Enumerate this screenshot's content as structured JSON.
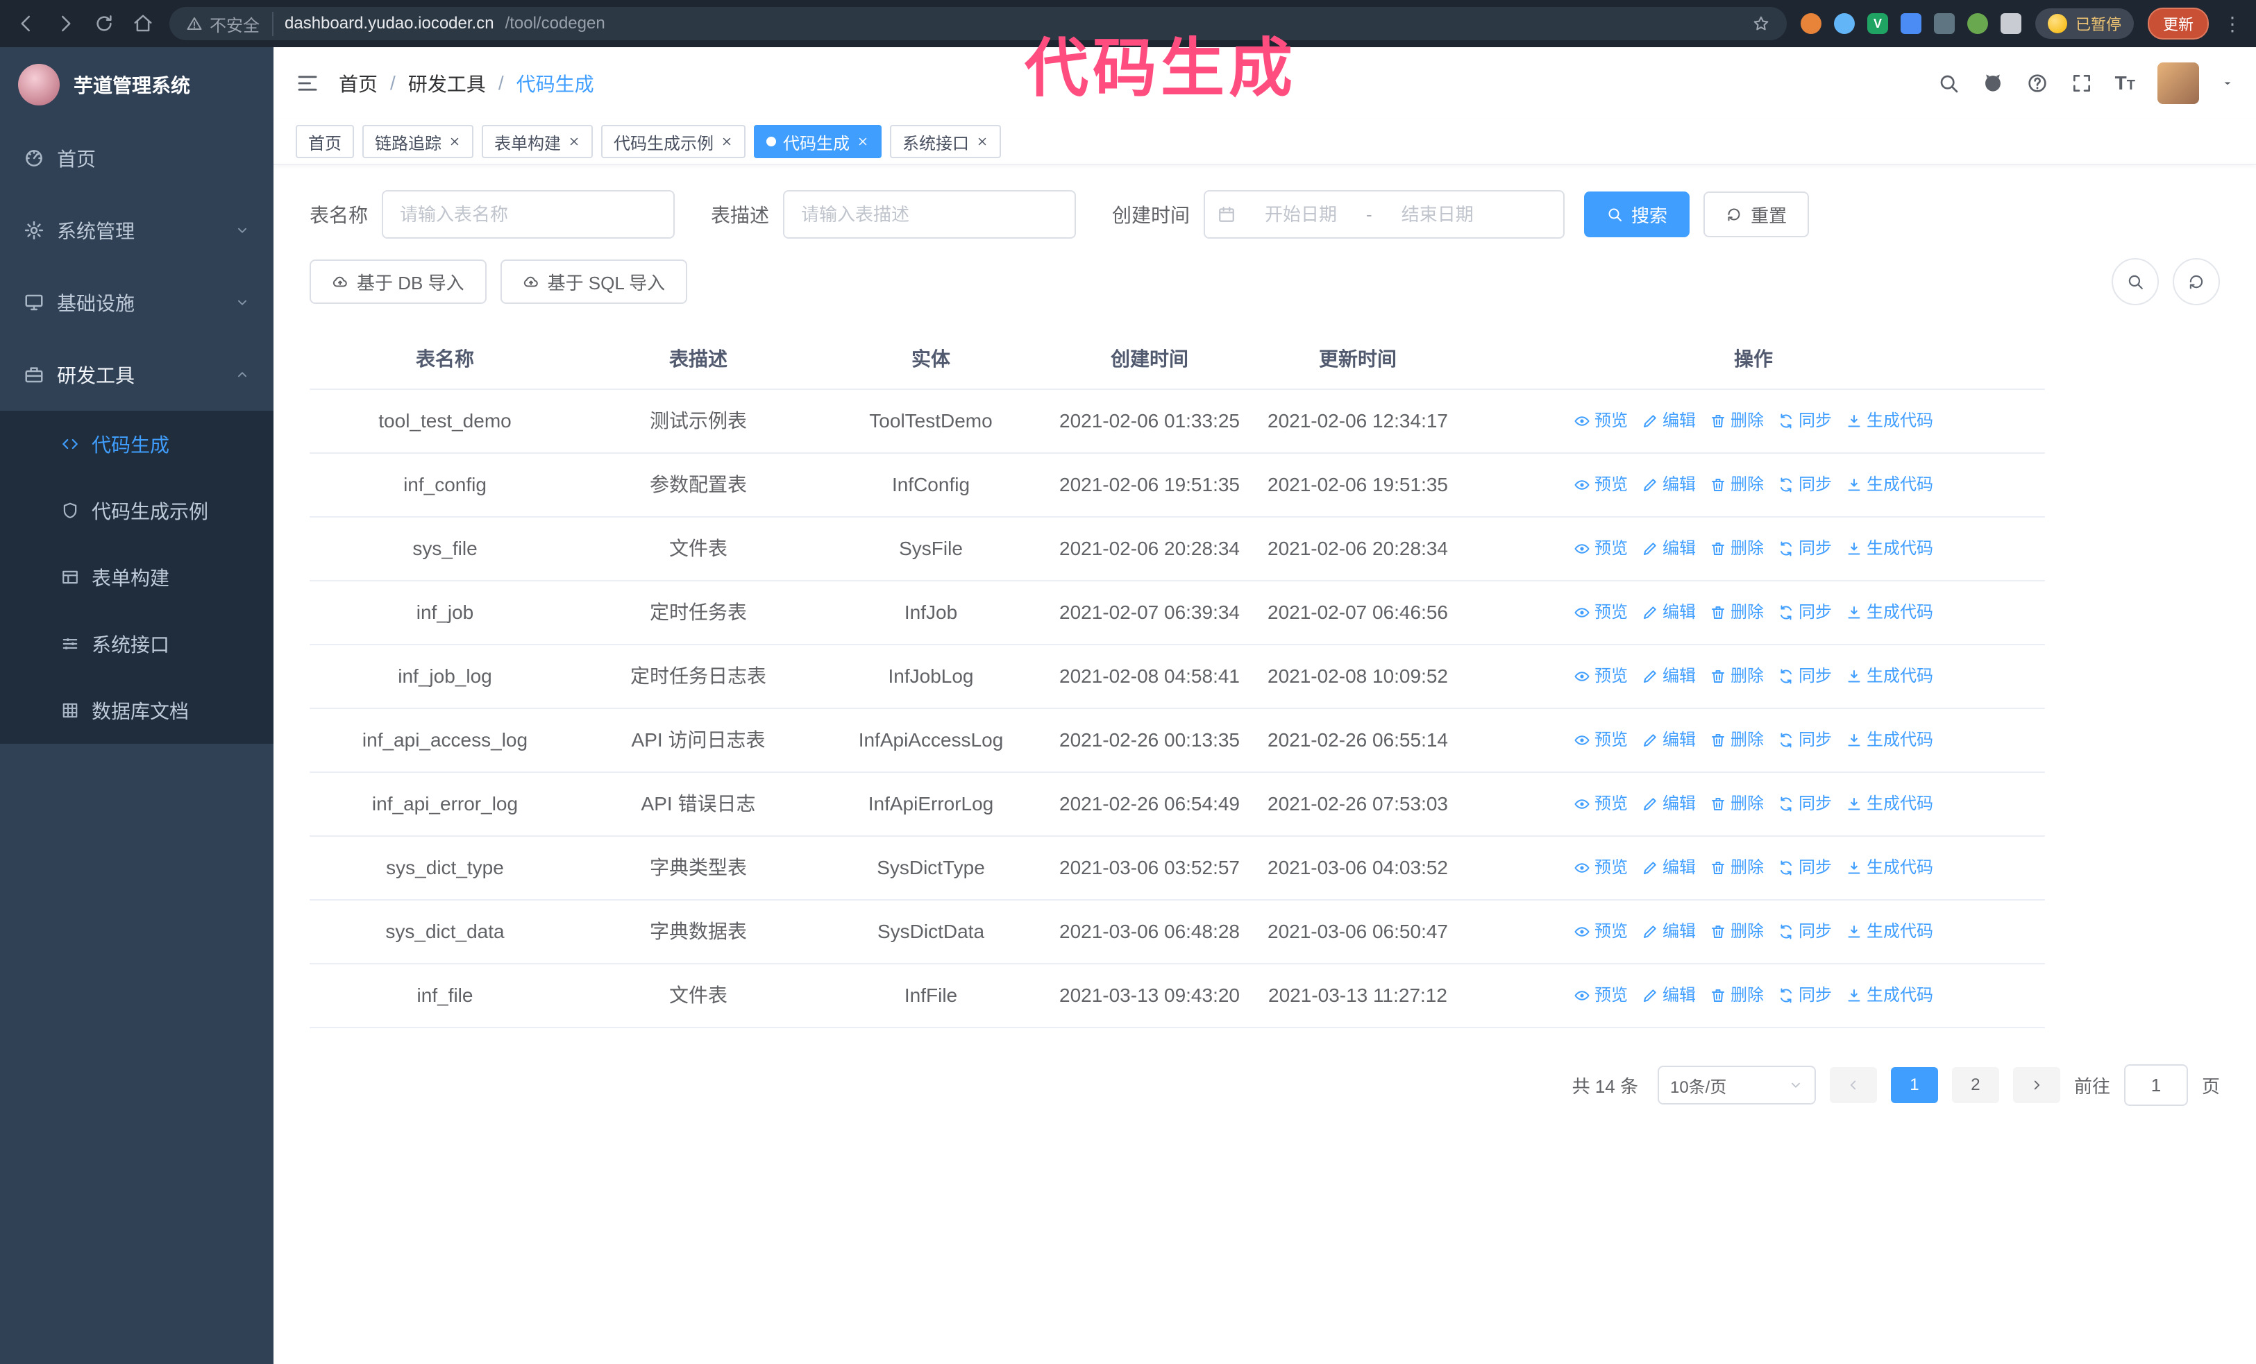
{
  "annotation": {
    "text": "代码生成",
    "color": "#ff4d7f"
  },
  "browser": {
    "security_text": "不安全",
    "url_host": "dashboard.yudao.iocoder.cn",
    "url_path": "/tool/codegen",
    "profile_chip": "已暂停",
    "update_button": "更新"
  },
  "sidebar": {
    "title": "芋道管理系统",
    "menu": [
      {
        "label": "首页",
        "icon": "dashboard"
      },
      {
        "label": "系统管理",
        "icon": "gear",
        "chevron": "down"
      },
      {
        "label": "基础设施",
        "icon": "monitor",
        "chevron": "down"
      },
      {
        "label": "研发工具",
        "icon": "toolbox",
        "chevron": "up",
        "open": true
      }
    ],
    "submenu": [
      {
        "label": "代码生成",
        "icon": "code",
        "active": true
      },
      {
        "label": "代码生成示例",
        "icon": "shield"
      },
      {
        "label": "表单构建",
        "icon": "form"
      },
      {
        "label": "系统接口",
        "icon": "api"
      },
      {
        "label": "数据库文档",
        "icon": "db"
      }
    ]
  },
  "header": {
    "breadcrumb": [
      "首页",
      "研发工具",
      "代码生成"
    ]
  },
  "tabs": [
    {
      "label": "首页"
    },
    {
      "label": "链路追踪",
      "closable": true
    },
    {
      "label": "表单构建",
      "closable": true
    },
    {
      "label": "代码生成示例",
      "closable": true
    },
    {
      "label": "代码生成",
      "closable": true,
      "active": true
    },
    {
      "label": "系统接口",
      "closable": true
    }
  ],
  "filters": {
    "table_name_label": "表名称",
    "table_name_placeholder": "请输入表名称",
    "table_desc_label": "表描述",
    "table_desc_placeholder": "请输入表描述",
    "create_time_label": "创建时间",
    "date_start_placeholder": "开始日期",
    "date_separator": "-",
    "date_end_placeholder": "结束日期",
    "search_button": "搜索",
    "reset_button": "重置"
  },
  "toolbar": {
    "import_db": "基于 DB 导入",
    "import_sql": "基于 SQL 导入"
  },
  "table": {
    "columns": [
      "表名称",
      "表描述",
      "实体",
      "创建时间",
      "更新时间",
      "操作"
    ],
    "actions": [
      {
        "label": "预览",
        "icon": "eye"
      },
      {
        "label": "编辑",
        "icon": "edit"
      },
      {
        "label": "删除",
        "icon": "delete"
      },
      {
        "label": "同步",
        "icon": "sync"
      },
      {
        "label": "生成代码",
        "icon": "download"
      }
    ],
    "rows": [
      {
        "name": "tool_test_demo",
        "desc": "测试示例表",
        "entity": "ToolTestDemo",
        "created": "2021-02-06 01:33:25",
        "updated": "2021-02-06 12:34:17"
      },
      {
        "name": "inf_config",
        "desc": "参数配置表",
        "entity": "InfConfig",
        "created": "2021-02-06 19:51:35",
        "updated": "2021-02-06 19:51:35"
      },
      {
        "name": "sys_file",
        "desc": "文件表",
        "entity": "SysFile",
        "created": "2021-02-06 20:28:34",
        "updated": "2021-02-06 20:28:34"
      },
      {
        "name": "inf_job",
        "desc": "定时任务表",
        "entity": "InfJob",
        "created": "2021-02-07 06:39:34",
        "updated": "2021-02-07 06:46:56"
      },
      {
        "name": "inf_job_log",
        "desc": "定时任务日志表",
        "entity": "InfJobLog",
        "created": "2021-02-08 04:58:41",
        "updated": "2021-02-08 10:09:52"
      },
      {
        "name": "inf_api_access_log",
        "desc": "API 访问日志表",
        "entity": "InfApiAccessLog",
        "created": "2021-02-26 00:13:35",
        "updated": "2021-02-26 06:55:14"
      },
      {
        "name": "inf_api_error_log",
        "desc": "API 错误日志",
        "entity": "InfApiErrorLog",
        "created": "2021-02-26 06:54:49",
        "updated": "2021-02-26 07:53:03"
      },
      {
        "name": "sys_dict_type",
        "desc": "字典类型表",
        "entity": "SysDictType",
        "created": "2021-03-06 03:52:57",
        "updated": "2021-03-06 04:03:52"
      },
      {
        "name": "sys_dict_data",
        "desc": "字典数据表",
        "entity": "SysDictData",
        "created": "2021-03-06 06:48:28",
        "updated": "2021-03-06 06:50:47"
      },
      {
        "name": "inf_file",
        "desc": "文件表",
        "entity": "InfFile",
        "created": "2021-03-13 09:43:20",
        "updated": "2021-03-13 11:27:12"
      }
    ]
  },
  "pagination": {
    "total_text": "共 14 条",
    "page_size": "10条/页",
    "pages": [
      "1",
      "2"
    ],
    "active_page": "1",
    "goto_label": "前往",
    "goto_value": "1",
    "goto_unit": "页"
  },
  "colors": {
    "accent": "#409eff",
    "sidebar_bg": "#304156",
    "submenu_bg": "#1f2d3d",
    "annotation": "#ff4d7f"
  }
}
